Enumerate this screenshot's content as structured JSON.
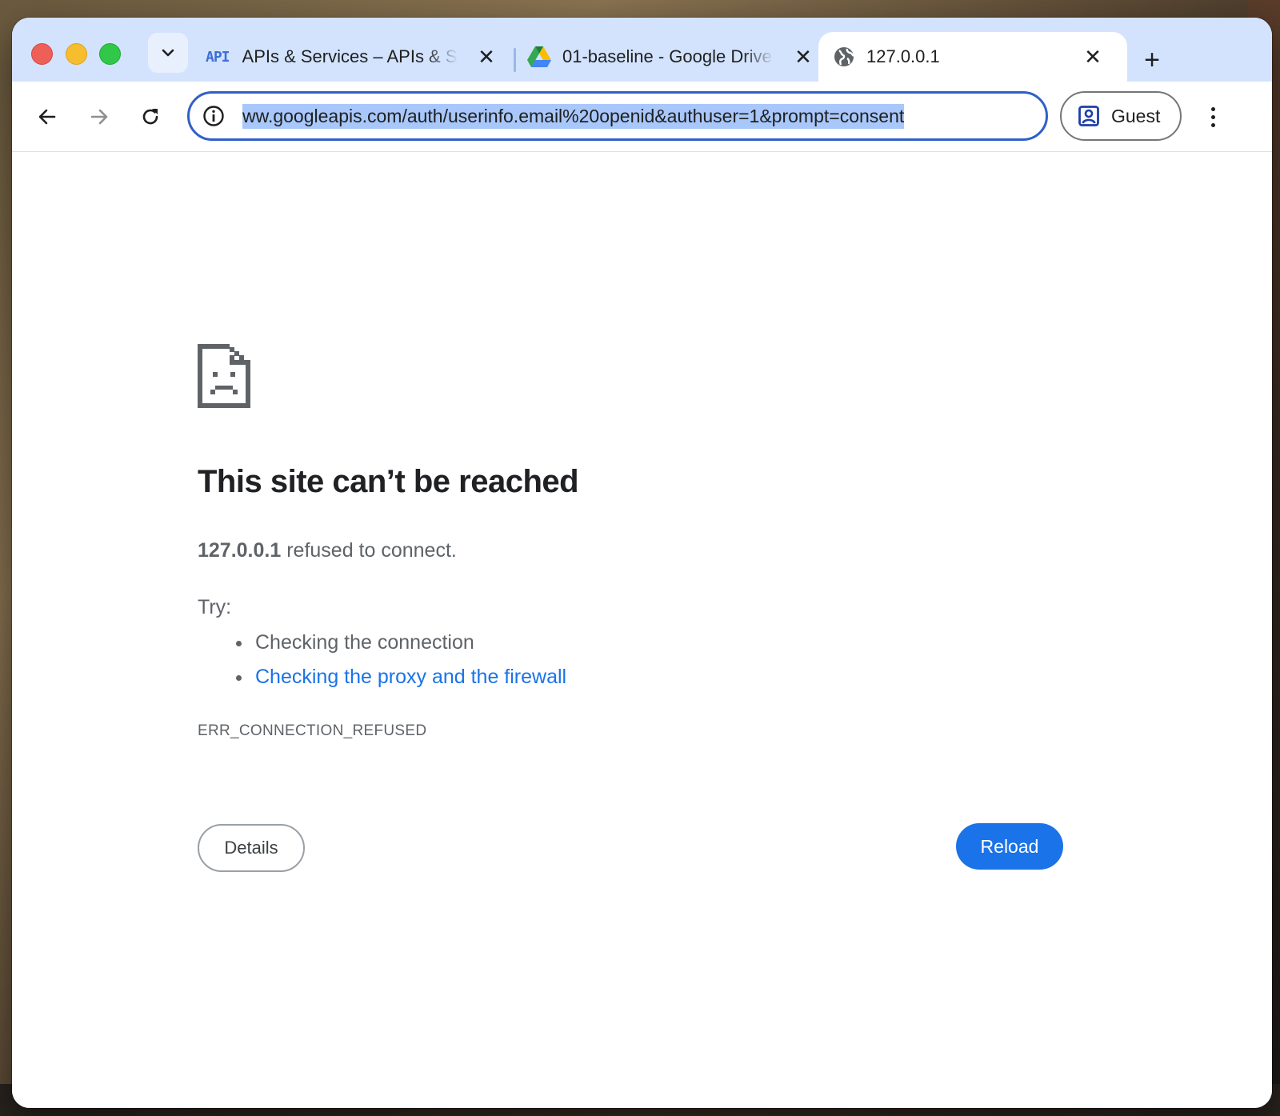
{
  "browser": {
    "tabs": [
      {
        "badge": "API",
        "title": "APIs & Services – APIs & Services",
        "close": "✕"
      },
      {
        "title": "01-baseline - Google Drive",
        "close": "✕"
      },
      {
        "title": "127.0.0.1",
        "close": "✕"
      }
    ],
    "new_tab": "+",
    "address_bar": {
      "url": "ww.googleapis.com/auth/userinfo.email%20openid&authuser=1&prompt=consent"
    },
    "profile": {
      "label": "Guest"
    }
  },
  "error_page": {
    "title": "This site can’t be reached",
    "host": "127.0.0.1",
    "summary_suffix": " refused to connect.",
    "try_label": "Try:",
    "suggestions": [
      "Checking the connection",
      "Checking the proxy and the firewall"
    ],
    "error_code": "ERR_CONNECTION_REFUSED",
    "details_button": "Details",
    "reload_button": "Reload"
  },
  "colors": {
    "tabstrip": "#d3e3fd",
    "omnibox_border": "#2f5fc8",
    "url_selection": "#a8c7fa",
    "link": "#1a73e8",
    "reload_button": "#1a73e8",
    "secondary_text": "#5f6368"
  },
  "icons": {
    "tab_search": "chevron-down-icon",
    "tab2": "google-drive-icon",
    "tab3": "globe-icon",
    "back": "arrow-left-icon",
    "forward": "arrow-right-icon",
    "reload": "reload-icon",
    "site_info": "info-icon",
    "profile": "person-badge-icon",
    "menu": "more-vertical-icon",
    "error": "sad-document-icon"
  }
}
